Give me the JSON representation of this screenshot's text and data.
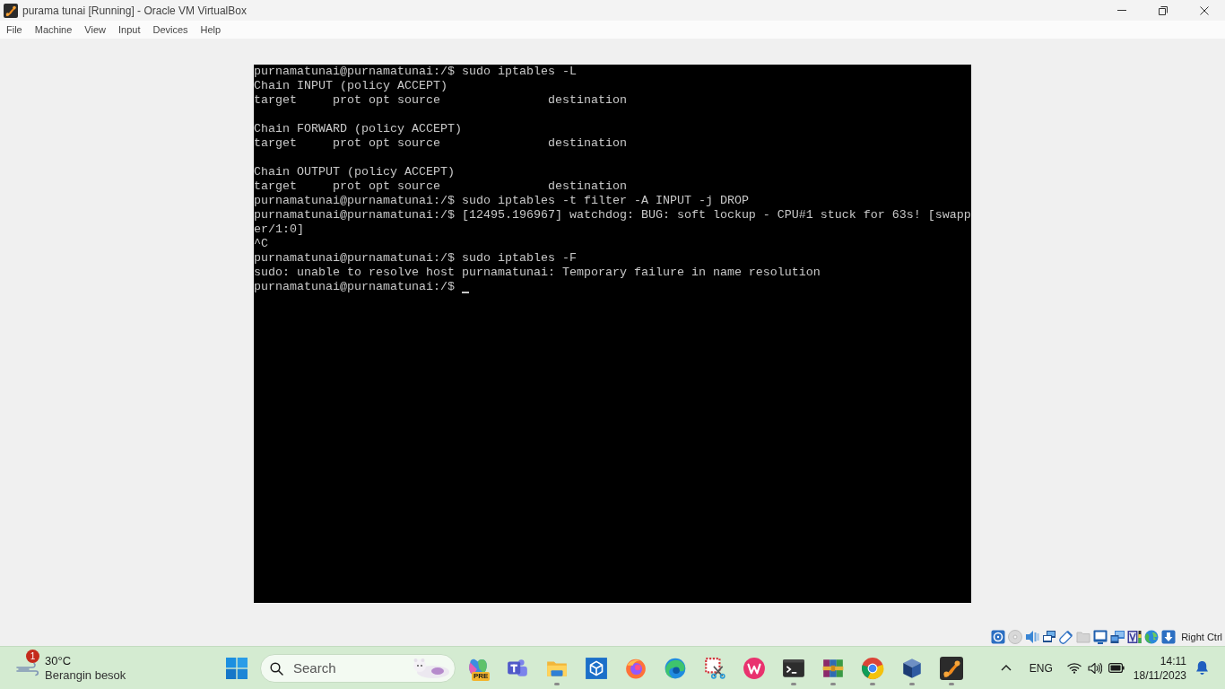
{
  "window": {
    "title": "purama tunai [Running] - Oracle VM VirtualBox"
  },
  "menu": [
    "File",
    "Machine",
    "View",
    "Input",
    "Devices",
    "Help"
  ],
  "terminal": {
    "blocks": [
      [
        "purnamatunai@purnamatunai:/$ sudo iptables -L",
        "Chain INPUT (policy ACCEPT)",
        "target     prot opt source               destination"
      ],
      [
        "Chain FORWARD (policy ACCEPT)",
        "target     prot opt source               destination"
      ],
      [
        "Chain OUTPUT (policy ACCEPT)",
        "target     prot opt source               destination",
        "purnamatunai@purnamatunai:/$ sudo iptables -t filter -A INPUT -j DROP",
        "purnamatunai@purnamatunai:/$ [12495.196967] watchdog: BUG: soft lockup - CPU#1 stuck for 63s! [swapp",
        "er/1:0]",
        "^C",
        "purnamatunai@purnamatunai:/$ sudo iptables -F",
        "sudo: unable to resolve host purnamatunai: Temporary failure in name resolution",
        "purnamatunai@purnamatunai:/$"
      ]
    ],
    "cursor": true
  },
  "status_bar": {
    "host_key": "Right Ctrl"
  },
  "taskbar": {
    "weather": {
      "badge": "1",
      "temperature": "30°C",
      "forecast": "Berangin besok"
    },
    "search": {
      "placeholder": "Search"
    },
    "apps": [
      {
        "kind": "blob",
        "badge": "PRE",
        "running": false
      },
      {
        "kind": "people",
        "running": false
      },
      {
        "kind": "folder",
        "running": true
      },
      {
        "kind": "cubetile",
        "running": false
      },
      {
        "kind": "flame",
        "running": false
      },
      {
        "kind": "wave",
        "running": false
      },
      {
        "kind": "snip",
        "running": false
      },
      {
        "kind": "circle",
        "running": false
      },
      {
        "kind": "console",
        "running": true
      },
      {
        "kind": "books",
        "running": true
      },
      {
        "kind": "ring",
        "running": true
      },
      {
        "kind": "cube",
        "running": true
      },
      {
        "kind": "swoosh",
        "running": true
      }
    ],
    "tray": {
      "language": "ENG",
      "time": "14:11",
      "date": "18/11/2023"
    }
  }
}
